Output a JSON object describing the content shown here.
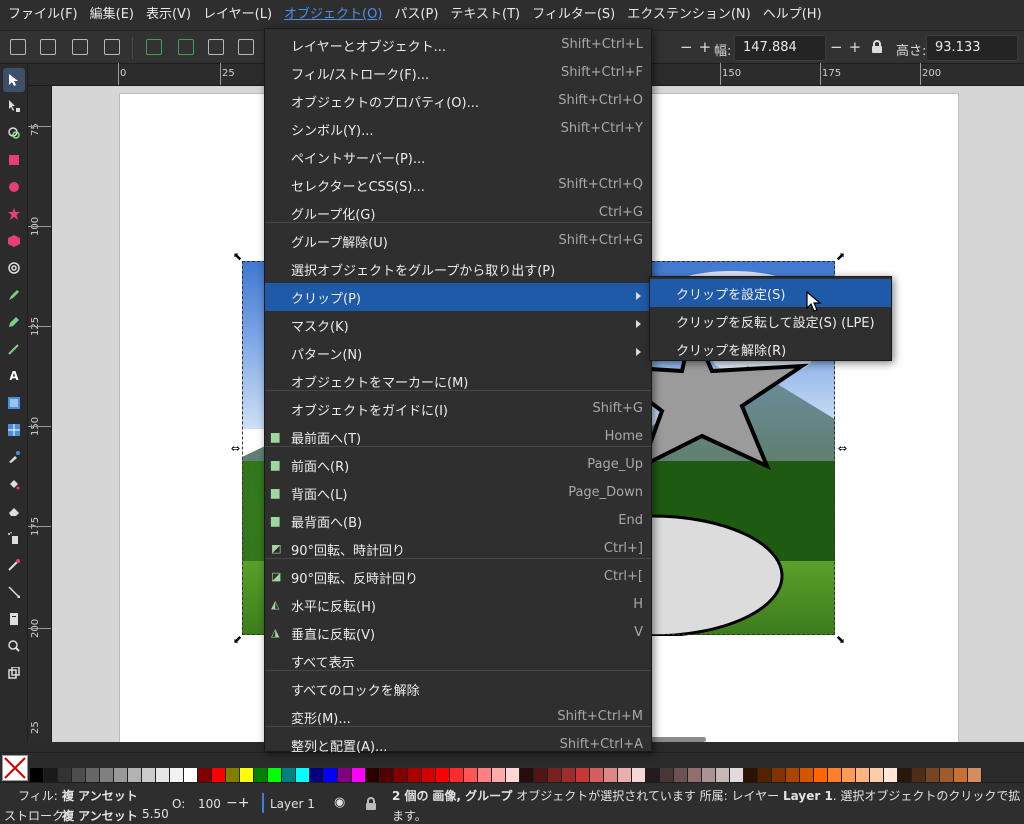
{
  "menubar": [
    "ファイル(F)",
    "編集(E)",
    "表示(V)",
    "レイヤー(L)",
    "オブジェクト(O)",
    "パス(P)",
    "テキスト(T)",
    "フィルター(S)",
    "エクステンション(N)",
    "ヘルプ(H)"
  ],
  "toolbar": {
    "width_label": "幅:",
    "width_value": "147.884",
    "height_label": "高さ:",
    "height_value": "93.133"
  },
  "ruler_top": [
    "0",
    "25",
    "150",
    "175",
    "200"
  ],
  "ruler_left": [
    "75",
    "100",
    "125",
    "150",
    "175",
    "200",
    "25"
  ],
  "menu": {
    "items": [
      {
        "label": "レイヤーとオブジェクト...",
        "shortcut": "Shift+Ctrl+L"
      },
      {
        "label": "フィル/ストローク(F)...",
        "shortcut": "Shift+Ctrl+F"
      },
      {
        "label": "オブジェクトのプロパティ(O)...",
        "shortcut": "Shift+Ctrl+O"
      },
      {
        "label": "シンボル(Y)...",
        "shortcut": "Shift+Ctrl+Y"
      },
      {
        "label": "ペイントサーバー(P)...",
        "shortcut": ""
      },
      {
        "label": "セレクターとCSS(S)...",
        "shortcut": "Shift+Ctrl+Q"
      },
      {
        "label": "グループ化(G)",
        "shortcut": "Ctrl+G"
      },
      {
        "label": "グループ解除(U)",
        "shortcut": "Shift+Ctrl+G"
      },
      {
        "label": "選択オブジェクトをグループから取り出す(P)",
        "shortcut": ""
      },
      {
        "label": "クリップ(P)",
        "shortcut": ""
      },
      {
        "label": "マスク(K)",
        "shortcut": ""
      },
      {
        "label": "パターン(N)",
        "shortcut": ""
      },
      {
        "label": "オブジェクトをマーカーに(M)",
        "shortcut": ""
      },
      {
        "label": "オブジェクトをガイドに(I)",
        "shortcut": "Shift+G"
      },
      {
        "label": "最前面へ(T)",
        "shortcut": "Home"
      },
      {
        "label": "前面へ(R)",
        "shortcut": "Page_Up"
      },
      {
        "label": "背面へ(L)",
        "shortcut": "Page_Down"
      },
      {
        "label": "最背面へ(B)",
        "shortcut": "End"
      },
      {
        "label": "90°回転、時計回り",
        "shortcut": "Ctrl+]"
      },
      {
        "label": "90°回転、反時計回り",
        "shortcut": "Ctrl+["
      },
      {
        "label": "水平に反転(H)",
        "shortcut": "H"
      },
      {
        "label": "垂直に反転(V)",
        "shortcut": "V"
      },
      {
        "label": "すべて表示",
        "shortcut": ""
      },
      {
        "label": "すべてのロックを解除",
        "shortcut": ""
      },
      {
        "label": "変形(M)...",
        "shortcut": "Shift+Ctrl+M"
      },
      {
        "label": "整列と配置(A)...",
        "shortcut": "Shift+Ctrl+A"
      }
    ]
  },
  "submenu": {
    "items": [
      {
        "label": "クリップを設定(S)"
      },
      {
        "label": "クリップを反転して設定(S) (LPE)"
      },
      {
        "label": "クリップを解除(R)"
      }
    ]
  },
  "status": {
    "fill_label": "フィル:",
    "fill_value": "複 アンセット",
    "stroke_label": "ストローク:",
    "stroke_value": "複 アンセット",
    "stroke_width": "5.50",
    "opacity_label": "O:",
    "opacity_value": "100",
    "layer": "Layer 1",
    "msg_count": "2 個の",
    "msg_type": "画像, グループ",
    "msg_rest": "オブジェクトが選択されています 所属: レイヤー",
    "msg_layer": "Layer 1",
    "msg_tail": ". 選択オブジェクトのクリックで拡",
    "msg_line2": "ます。"
  },
  "palette": [
    "#000000",
    "#1a1a1a",
    "#333333",
    "#4d4d4d",
    "#666666",
    "#808080",
    "#999999",
    "#b3b3b3",
    "#cccccc",
    "#e6e6e6",
    "#f2f2f2",
    "#ffffff",
    "#800000",
    "#ff0000",
    "#808000",
    "#ffff00",
    "#008000",
    "#00ff00",
    "#008080",
    "#00ffff",
    "#000080",
    "#0000ff",
    "#800080",
    "#ff00ff",
    "#2b0000",
    "#550000",
    "#800000",
    "#aa0000",
    "#d40000",
    "#ff0000",
    "#ff2a2a",
    "#ff5555",
    "#ff8080",
    "#ffaaaa",
    "#ffd5d5",
    "#280b0b",
    "#501616",
    "#782121",
    "#a02c2c",
    "#c83737",
    "#d35f5f",
    "#de8787",
    "#e9afaf",
    "#f4d7d7",
    "#241c1c",
    "#483737",
    "#6c5353",
    "#916f6f",
    "#ac9393",
    "#c8b7b7",
    "#e3dbdb",
    "#2b1100",
    "#552200",
    "#803300",
    "#aa4400",
    "#d45500",
    "#ff6600",
    "#ff7f2a",
    "#ff9955",
    "#ffb380",
    "#ffccaa",
    "#ffe6d5",
    "#28170b",
    "#502d16",
    "#784421",
    "#a05a2c",
    "#c87137",
    "#d38d5f"
  ]
}
